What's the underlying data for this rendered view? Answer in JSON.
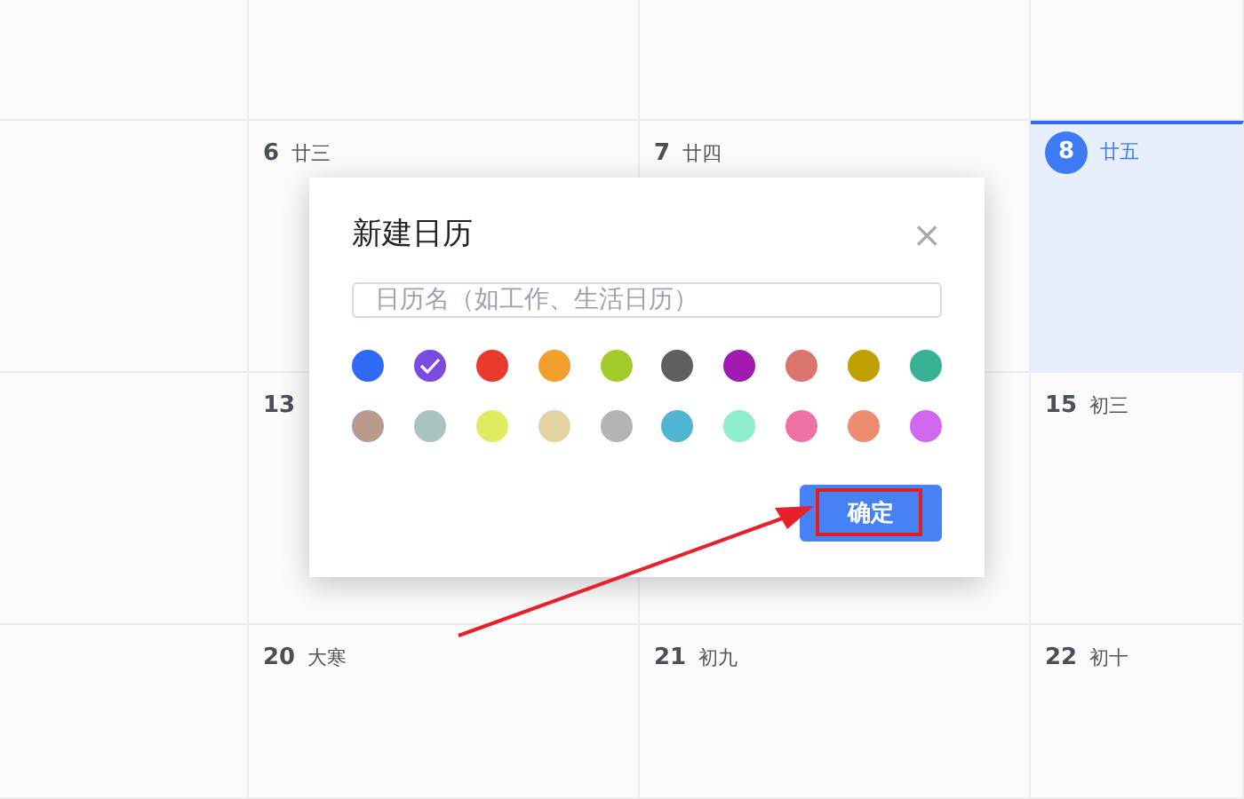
{
  "calendar": {
    "weeks": [
      {
        "cells": [
          {
            "today": false
          },
          {
            "today": false
          },
          {
            "today": false
          },
          {
            "today": false
          }
        ]
      },
      {
        "cells": [
          {
            "today": false
          },
          {
            "day": "6",
            "lunar": "廿三",
            "today": false
          },
          {
            "day": "7",
            "lunar": "廿四",
            "today": false
          },
          {
            "day": "8",
            "lunar": "廿五",
            "today": true
          }
        ]
      },
      {
        "cells": [
          {
            "today": false
          },
          {
            "day": "13",
            "today": false
          },
          {
            "today": false
          },
          {
            "day": "15",
            "lunar": "初三",
            "today": false
          }
        ]
      },
      {
        "cells": [
          {
            "today": false
          },
          {
            "day": "20",
            "lunar": "大寒",
            "today": false
          },
          {
            "day": "21",
            "lunar": "初九",
            "today": false
          },
          {
            "day": "22",
            "lunar": "初十",
            "today": false
          }
        ]
      }
    ]
  },
  "dialog": {
    "title": "新建日历",
    "close": "×",
    "name_field": {
      "placeholder": "日历名（如工作、生活日历）"
    },
    "colors": [
      {
        "color": "#2e6af5",
        "selected": false
      },
      {
        "color": "#7b4ae0",
        "selected": true
      },
      {
        "color": "#ea3a2e",
        "selected": false
      },
      {
        "color": "#f09f2a",
        "selected": false
      },
      {
        "color": "#a3cc2a",
        "selected": false
      },
      {
        "color": "#5f5f5f",
        "selected": false
      },
      {
        "color": "#a01ab0",
        "selected": false
      },
      {
        "color": "#d9756d",
        "selected": false
      },
      {
        "color": "#c0a000",
        "selected": false
      },
      {
        "color": "#37b294",
        "selected": false
      },
      {
        "color": "#b89a8f",
        "selected": false
      },
      {
        "color": "#a9c4c0",
        "selected": false
      },
      {
        "color": "#dfec62",
        "selected": false
      },
      {
        "color": "#e3d3a3",
        "selected": false
      },
      {
        "color": "#b4b3b6",
        "selected": false
      },
      {
        "color": "#4fb5d0",
        "selected": false
      },
      {
        "color": "#8eefcf",
        "selected": false
      },
      {
        "color": "#ee72a4",
        "selected": false
      },
      {
        "color": "#ee8c70",
        "selected": false
      },
      {
        "color": "#cf67f0",
        "selected": false
      }
    ],
    "confirm": "确定"
  }
}
